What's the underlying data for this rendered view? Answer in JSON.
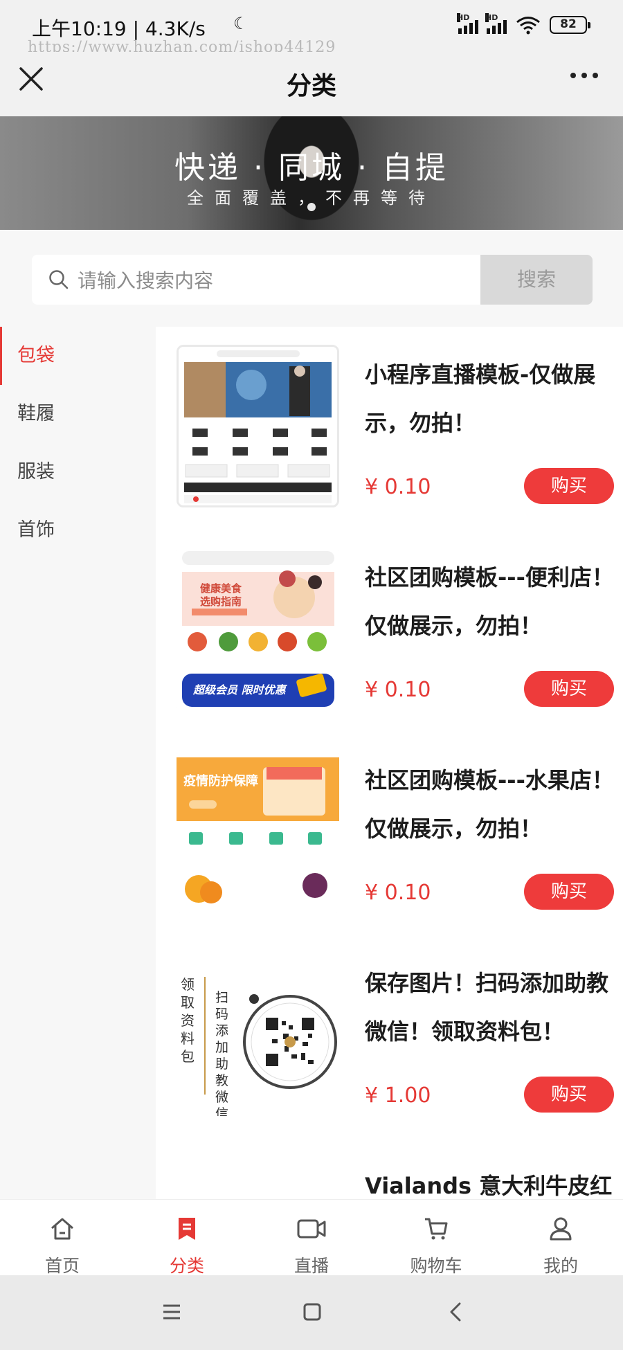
{
  "status_bar": {
    "time_speed": "上午10:19 | 4.3K/s",
    "watermark": "https://www.huzhan.com/ishop44129",
    "battery": "82"
  },
  "header": {
    "title": "分类"
  },
  "banner": {
    "title": "快递 · 同城 · 自提",
    "subtitle": "全面覆盖，不再等待"
  },
  "search": {
    "placeholder": "请输入搜索内容",
    "button_label": "搜索"
  },
  "sidebar": {
    "items": [
      {
        "label": "包袋"
      },
      {
        "label": "鞋履"
      },
      {
        "label": "服装"
      },
      {
        "label": "首饰"
      }
    ]
  },
  "products": [
    {
      "name": "小程序直播模板-仅做展示，勿拍！",
      "price": "¥ 0.10",
      "buy": "购买"
    },
    {
      "name": "社区团购模板---便利店！仅做展示，勿拍！",
      "price": "¥ 0.10",
      "buy": "购买"
    },
    {
      "name": "社区团购模板---水果店！仅做展示，勿拍！",
      "price": "¥ 0.10",
      "buy": "购买"
    },
    {
      "name": "保存图片！扫码添加助教微信！领取资料包！",
      "price": "¥ 1.00",
      "buy": "购买"
    },
    {
      "name": "Vialands 意大利牛皮红"
    }
  ],
  "thumb_text": {
    "p2_banner": "健康美食 选购指南",
    "p2_vip": "超级会员 限时优惠",
    "p3_banner": "疫情防护保障",
    "p4_left": "领取资料包",
    "p4_mid": "扫码添加助教微信"
  },
  "tabbar": {
    "items": [
      {
        "label": "首页"
      },
      {
        "label": "分类"
      },
      {
        "label": "直播"
      },
      {
        "label": "购物车"
      },
      {
        "label": "我的"
      }
    ]
  },
  "colors": {
    "accent": "#e53935",
    "buy_button": "#ee3b3b"
  }
}
